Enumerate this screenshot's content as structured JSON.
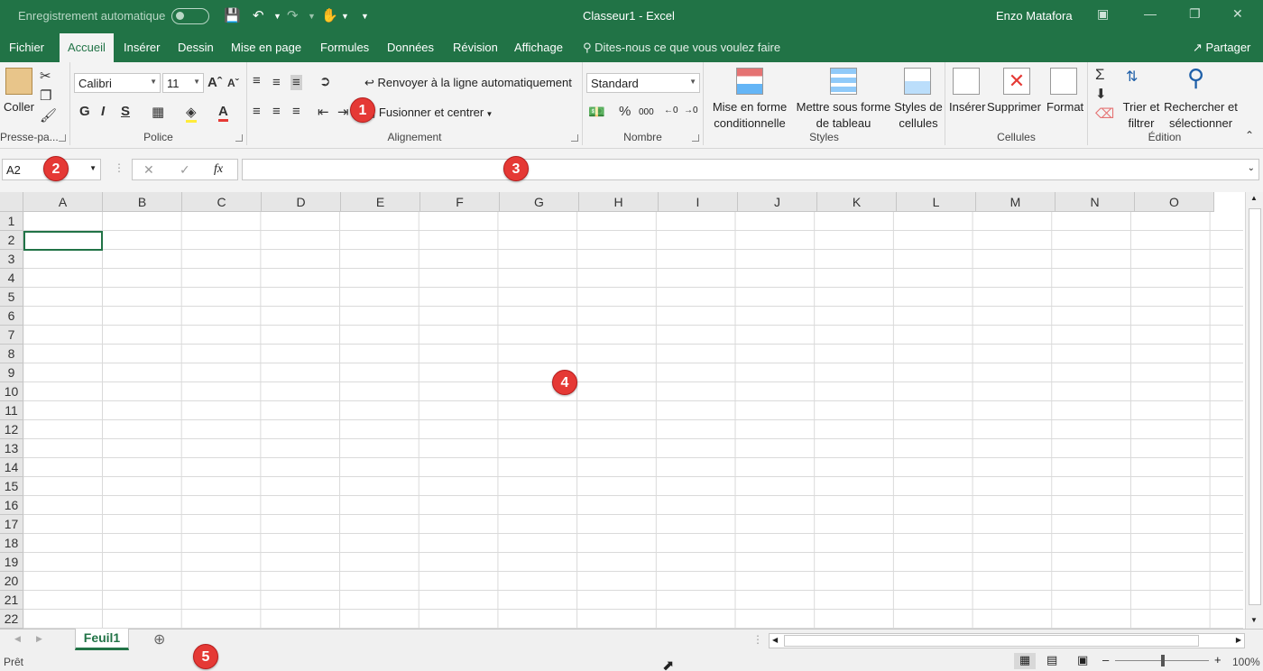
{
  "titlebar": {
    "autosave_label": "Enregistrement automatique",
    "doc_title": "Classeur1  -  Excel",
    "user": "Enzo Matafora"
  },
  "tabs": [
    "Fichier",
    "Accueil",
    "Insérer",
    "Dessin",
    "Mise en page",
    "Formules",
    "Données",
    "Révision",
    "Affichage"
  ],
  "active_tab": "Accueil",
  "tell_me": "Dites-nous ce que vous voulez faire",
  "share": "Partager",
  "ribbon": {
    "clipboard": {
      "paste": "Coller",
      "label": "Presse-pa..."
    },
    "font": {
      "name": "Calibri",
      "size": "11",
      "bold": "G",
      "italic": "I",
      "underline": "S",
      "label": "Police"
    },
    "alignment": {
      "wrap": "Renvoyer à la ligne automatiquement",
      "merge": "Fusionner et centrer",
      "label": "Alignement"
    },
    "number": {
      "format": "Standard",
      "percent": "%",
      "thousands": "000",
      "label": "Nombre"
    },
    "styles": {
      "conditional_1": "Mise en forme",
      "conditional_2": "conditionnelle",
      "table_1": "Mettre sous forme",
      "table_2": "de tableau",
      "cell_1": "Styles de",
      "cell_2": "cellules",
      "label": "Styles"
    },
    "cells": {
      "insert": "Insérer",
      "delete": "Supprimer",
      "format": "Format",
      "label": "Cellules"
    },
    "editing": {
      "sort_1": "Trier et",
      "sort_2": "filtrer",
      "find_1": "Rechercher et",
      "find_2": "sélectionner",
      "label": "Édition"
    }
  },
  "formula_bar": {
    "name_box": "A2",
    "fx": "fx",
    "value": ""
  },
  "columns": [
    "A",
    "B",
    "C",
    "D",
    "E",
    "F",
    "G",
    "H",
    "I",
    "J",
    "K",
    "L",
    "M",
    "N",
    "O"
  ],
  "rows": [
    "1",
    "2",
    "3",
    "4",
    "5",
    "6",
    "7",
    "8",
    "9",
    "10",
    "11",
    "12",
    "13",
    "14",
    "15",
    "16",
    "17",
    "18",
    "19",
    "20",
    "21",
    "22"
  ],
  "sheet_tab": "Feuil1",
  "status": "Prêt",
  "zoom": "100%",
  "callouts": [
    "1",
    "2",
    "3",
    "4",
    "5"
  ],
  "colors": {
    "accent": "#217346",
    "callout": "#e53935"
  }
}
